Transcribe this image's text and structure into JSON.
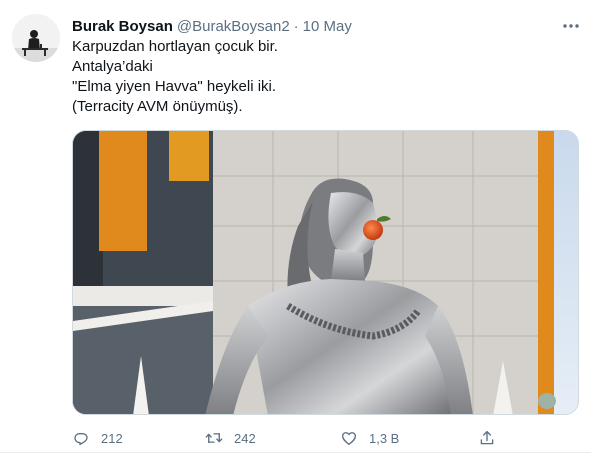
{
  "tweet": {
    "author_name": "Burak Boysan",
    "handle": "@BurakBoysan2",
    "separator": "·",
    "date": "10 May",
    "lines": [
      "Karpuzdan hortlayan çocuk bir.",
      "Antalya’daki",
      "\"Elma yiyen Havva\" heykeli iki.",
      "(Terracity AVM önüymüş)."
    ],
    "image_icon": "statue-photo",
    "avatar_icon": "person-silhouette-avatar"
  },
  "actions": {
    "reply_count": "212",
    "retweet_count": "242",
    "like_count": "1,3 B",
    "reply_icon": "reply-icon",
    "retweet_icon": "retweet-icon",
    "like_icon": "heart-icon",
    "share_icon": "share-icon",
    "more_icon": "more-icon"
  },
  "colors": {
    "text_primary": "#0f1419",
    "text_secondary": "#5b7083",
    "border": "#cfd9de"
  }
}
